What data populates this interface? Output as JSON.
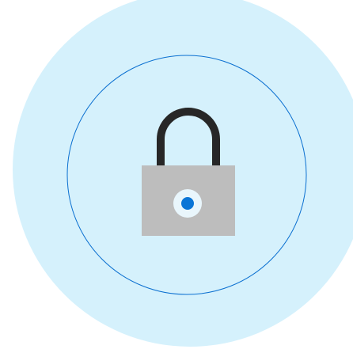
{
  "illustration": {
    "icon": "lock-icon",
    "colors": {
      "background": "#ffffff",
      "outer_circle": "#d5f1fc",
      "ring_stroke": "#0a6fd0",
      "shackle": "#272727",
      "lock_body": "#bdbdbd",
      "keyhole_ring": "#e9f6fc",
      "keyhole_dot": "#0a75d6"
    }
  }
}
